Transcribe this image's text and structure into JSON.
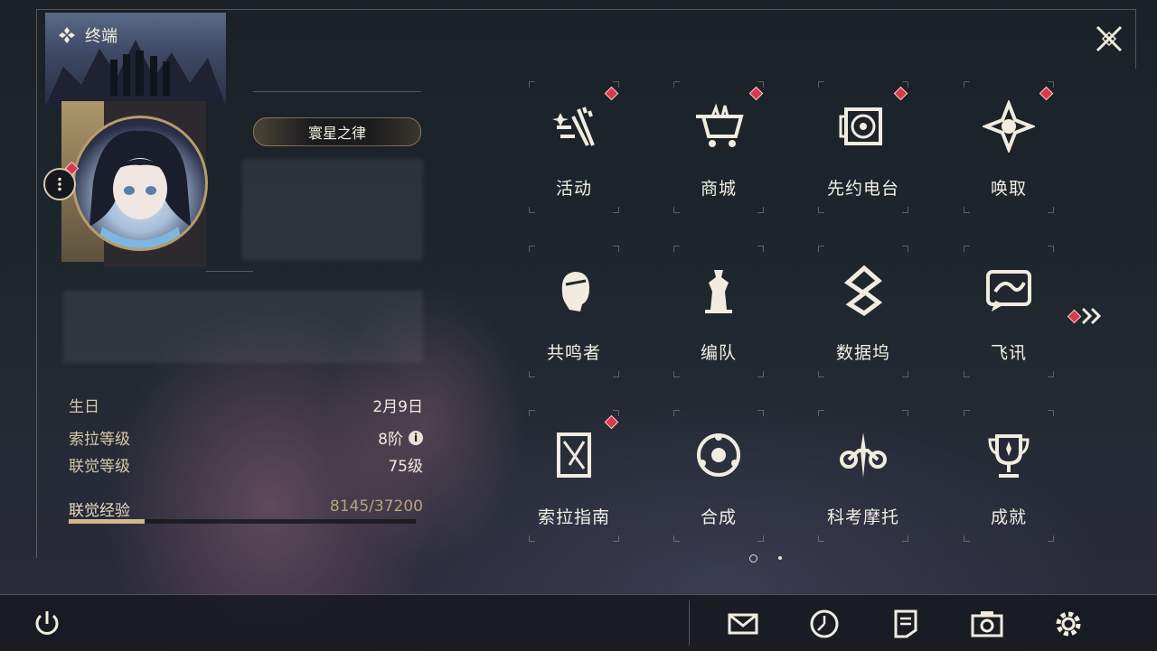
{
  "header": {
    "section_title": "终端"
  },
  "profile": {
    "title_badge": "寰星之律"
  },
  "stats": [
    {
      "label": "生日",
      "value": "2月9日"
    },
    {
      "label": "索拉等级",
      "value": "8阶"
    },
    {
      "label": "联觉等级",
      "value": "75级"
    }
  ],
  "experience": {
    "label": "联觉经验",
    "value_text": "8145/37200",
    "current": 8145,
    "max": 37200
  },
  "menu": [
    {
      "label": "活动",
      "icon": "activity-icon",
      "badge": true
    },
    {
      "label": "商城",
      "icon": "shop-icon",
      "badge": true
    },
    {
      "label": "先约电台",
      "icon": "radio-icon",
      "badge": true
    },
    {
      "label": "唤取",
      "icon": "summon-icon",
      "badge": true
    },
    {
      "label": "共鸣者",
      "icon": "resonator-icon",
      "badge": false
    },
    {
      "label": "编队",
      "icon": "team-icon",
      "badge": false
    },
    {
      "label": "数据坞",
      "icon": "data-bank-icon",
      "badge": false
    },
    {
      "label": "飞讯",
      "icon": "message-icon",
      "badge": false
    },
    {
      "label": "索拉指南",
      "icon": "guidebook-icon",
      "badge": true
    },
    {
      "label": "合成",
      "icon": "synthesis-icon",
      "badge": false
    },
    {
      "label": "科考摩托",
      "icon": "motorcycle-icon",
      "badge": false
    },
    {
      "label": "成就",
      "icon": "trophy-icon",
      "badge": false
    }
  ],
  "bottom_bar": [
    "power-icon",
    "mail-icon",
    "clock-icon",
    "notes-icon",
    "camera-icon",
    "settings-icon"
  ],
  "colors": {
    "accent_gold": "#d2b88a",
    "badge_red": "#d83a4a",
    "text": "#f3efe4"
  }
}
